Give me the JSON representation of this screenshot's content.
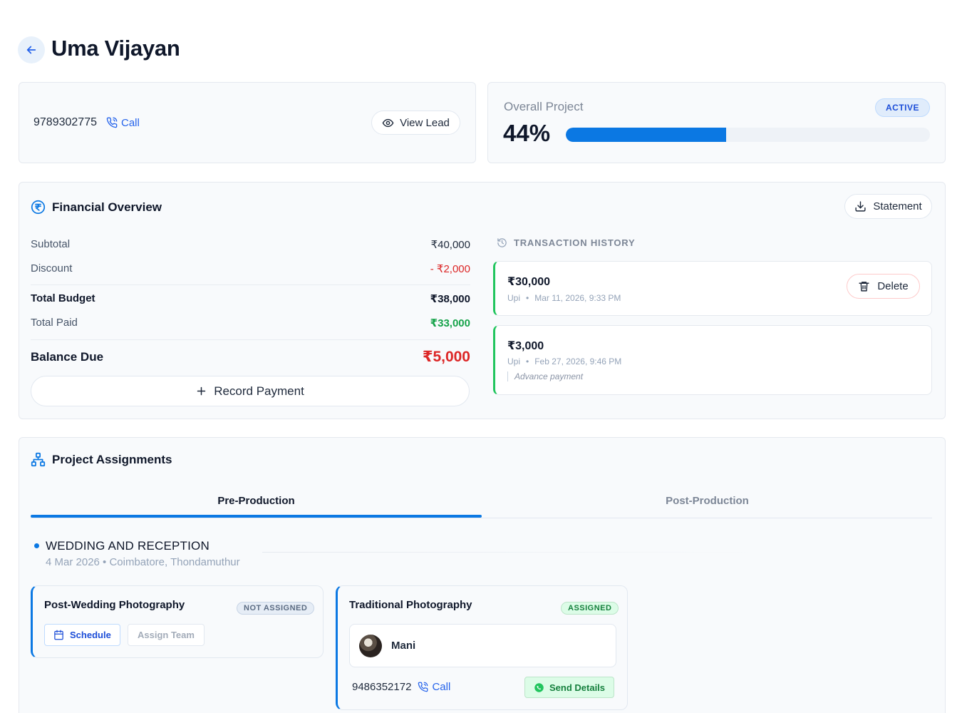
{
  "header": {
    "title": "Uma Vijayan"
  },
  "contact": {
    "phone": "9789302775",
    "call_label": "Call",
    "view_lead_label": "View Lead"
  },
  "progress": {
    "label": "Overall Project",
    "status": "ACTIVE",
    "percent_text": "44%",
    "percent": 44
  },
  "financial": {
    "title": "Financial Overview",
    "statement_label": "Statement",
    "rows": {
      "subtotal": {
        "label": "Subtotal",
        "value": "₹40,000"
      },
      "discount": {
        "label": "Discount",
        "value": "- ₹2,000"
      },
      "total_budget": {
        "label": "Total Budget",
        "value": "₹38,000"
      },
      "total_paid": {
        "label": "Total Paid",
        "value": "₹33,000"
      },
      "balance_due": {
        "label": "Balance Due",
        "value": "₹5,000"
      }
    },
    "record_payment_label": "Record Payment",
    "transactions": {
      "heading": "TRANSACTION HISTORY",
      "items": [
        {
          "amount": "₹30,000",
          "method": "Upi",
          "datetime": "Mar 11, 2026, 9:33 PM",
          "delete_label": "Delete"
        },
        {
          "amount": "₹3,000",
          "method": "Upi",
          "datetime": "Feb 27, 2026, 9:46 PM",
          "note": "Advance payment"
        }
      ]
    }
  },
  "assignments": {
    "title": "Project Assignments",
    "tabs": [
      {
        "label": "Pre-Production"
      },
      {
        "label": "Post-Production"
      }
    ],
    "event": {
      "title": "WEDDING AND RECEPTION",
      "meta": "4 Mar 2026 • Coimbatore, Thondamuthur"
    },
    "roles": [
      {
        "title": "Post-Wedding Photography",
        "status": "NOT ASSIGNED",
        "schedule_label": "Schedule",
        "assign_team_label": "Assign Team"
      },
      {
        "title": "Traditional Photography",
        "status": "ASSIGNED",
        "member": {
          "name": "Mani",
          "phone": "9486352172",
          "call_label": "Call"
        },
        "send_label": "Send Details"
      }
    ]
  },
  "colors": {
    "accent": "#0b78e3",
    "danger": "#dc2626",
    "success": "#16a34a"
  }
}
